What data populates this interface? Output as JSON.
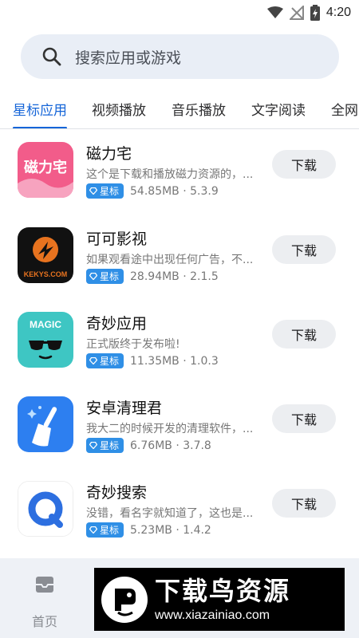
{
  "status_bar": {
    "time": "4:20",
    "icons": [
      "wifi-icon",
      "signal-off-icon",
      "battery-charging-icon"
    ]
  },
  "search": {
    "placeholder": "搜索应用或游戏",
    "icon": "search-icon"
  },
  "tabs": [
    {
      "label": "星标应用",
      "active": true
    },
    {
      "label": "视频播放",
      "active": false
    },
    {
      "label": "音乐播放",
      "active": false
    },
    {
      "label": "文字阅读",
      "active": false
    },
    {
      "label": "全网",
      "active": false
    }
  ],
  "apps": [
    {
      "name": "磁力宅",
      "desc": "这个是下载和播放磁力资源的，...",
      "badge": "星标",
      "meta": "54.85MB · 5.3.9",
      "button": "下载",
      "icon": "cilizhai-app-icon",
      "icon_text": "磁力宅"
    },
    {
      "name": "可可影视",
      "desc": "如果观看途中出现任何广告，不...",
      "badge": "星标",
      "meta": "28.94MB · 2.1.5",
      "button": "下载",
      "icon": "kekys-app-icon",
      "icon_text": "KEKYS.COM"
    },
    {
      "name": "奇妙应用",
      "desc": "正式版终于发布啦!",
      "badge": "星标",
      "meta": "11.35MB · 1.0.3",
      "button": "下载",
      "icon": "magic-app-icon",
      "icon_text": "MAGIC"
    },
    {
      "name": "安卓清理君",
      "desc": "我大二的时候开发的清理软件，...",
      "badge": "星标",
      "meta": "6.76MB · 3.7.8",
      "button": "下载",
      "icon": "broom-app-icon"
    },
    {
      "name": "奇妙搜索",
      "desc": "没错，看名字就知道了，这也是...",
      "badge": "星标",
      "meta": "5.23MB · 1.4.2",
      "button": "下载",
      "icon": "search-q-app-icon"
    }
  ],
  "bottom_nav": {
    "home_label": "首页",
    "home_icon": "inbox-icon"
  },
  "watermark": {
    "title": "下载鸟资源",
    "url": "www.xiazainiao.com"
  },
  "colors": {
    "accent": "#1565d8",
    "badge": "#2f8fe6",
    "search_bg": "#e9eef6",
    "button_bg": "#eceef1"
  }
}
